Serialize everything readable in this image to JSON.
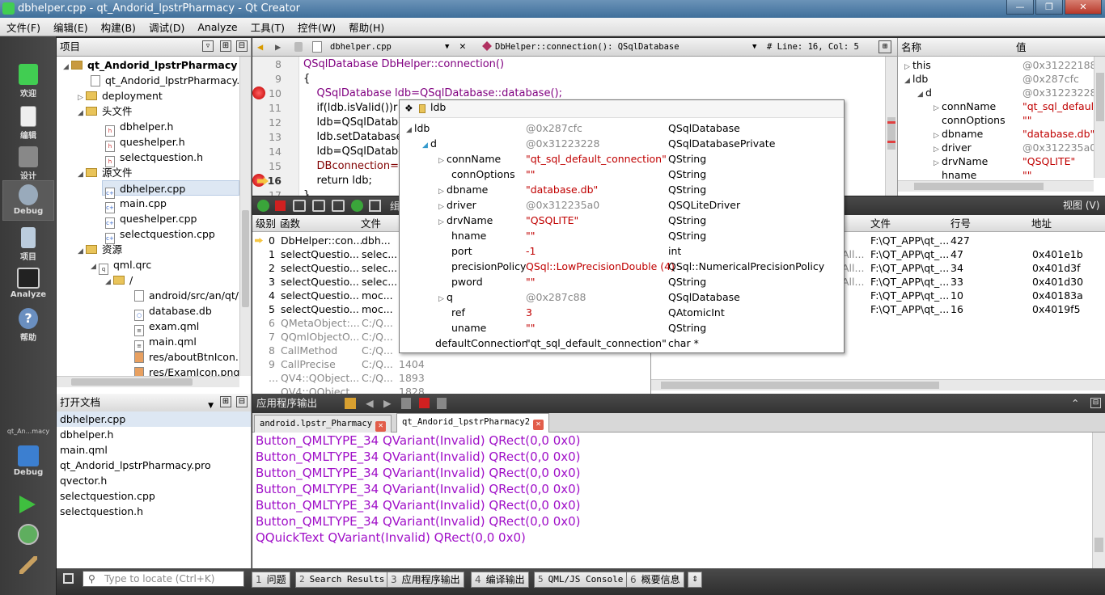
{
  "window": {
    "title": "dbhelper.cpp - qt_Andorid_lpstrPharmacy - Qt Creator"
  },
  "menu": [
    "文件(F)",
    "编辑(E)",
    "构建(B)",
    "调试(D)",
    "Analyze",
    "工具(T)",
    "控件(W)",
    "帮助(H)"
  ],
  "modes": [
    {
      "label": "欢迎",
      "icon": "qt-welcome-icon"
    },
    {
      "label": "编辑",
      "icon": "edit-icon"
    },
    {
      "label": "设计",
      "icon": "design-icon"
    },
    {
      "label": "Debug",
      "icon": "debug-bug-icon"
    },
    {
      "label": "项目",
      "icon": "project-icon"
    },
    {
      "label": "Analyze",
      "icon": "analyze-icon"
    },
    {
      "label": "帮助",
      "icon": "help-icon"
    }
  ],
  "kit": {
    "name": "qt_An...macy",
    "mode": "Debug"
  },
  "project_pane": {
    "title": "项目",
    "root": "qt_Andorid_lpstrPharmacy",
    "items": [
      "qt_Andorid_lpstrPharmacy.p",
      "deployment",
      "头文件",
      "dbhelper.h",
      "queshelper.h",
      "selectquestion.h",
      "源文件",
      "dbhelper.cpp",
      "main.cpp",
      "queshelper.cpp",
      "selectquestion.cpp",
      "资源",
      "qml.qrc",
      "/",
      "android/src/an/qt/",
      "database.db",
      "exam.qml",
      "main.qml",
      "res/aboutBtnIcon.p",
      "res/ExamIcon.png"
    ]
  },
  "open_docs": {
    "title": "打开文档",
    "items": [
      "dbhelper.cpp",
      "dbhelper.h",
      "main.qml",
      "qt_Andorid_lpstrPharmacy.pro",
      "qvector.h",
      "selectquestion.cpp",
      "selectquestion.h"
    ]
  },
  "editor": {
    "file": "dbhelper.cpp",
    "function": "DbHelper::connection(): QSqlDatabase",
    "position": "# Line: 16, Col: 5",
    "lines": [
      {
        "n": "8",
        "text": "QSqlDatabase DbHelper::connection()"
      },
      {
        "n": "9",
        "text": "{"
      },
      {
        "n": "10",
        "text": "    QSqlDatabase ldb=QSqlDatabase::database();"
      },
      {
        "n": "11",
        "text": "    if(ldb.isValid())r"
      },
      {
        "n": "12",
        "text": "    ldb=QSqlDatabc"
      },
      {
        "n": "13",
        "text": "    ldb.setDatabasel"
      },
      {
        "n": "14",
        "text": "    ldb=QSqlDatabc"
      },
      {
        "n": "15",
        "text": "    DBconnection=lc"
      },
      {
        "n": "16",
        "text": "    return ldb;"
      },
      {
        "n": "17",
        "text": "}"
      }
    ]
  },
  "tooltip": {
    "title": "ldb",
    "rows": [
      {
        "name": "ldb",
        "value": "@0x287cfc",
        "type": "QSqlDatabase"
      },
      {
        "name": "d",
        "value": "@0x31223228",
        "type": "QSqlDatabasePrivate"
      },
      {
        "name": "connName",
        "value": "\"qt_sql_default_connection\"",
        "type": "QString"
      },
      {
        "name": "connOptions",
        "value": "\"\"",
        "type": "QString"
      },
      {
        "name": "dbname",
        "value": "\"database.db\"",
        "type": "QString"
      },
      {
        "name": "driver",
        "value": "@0x312235a0",
        "type": "QSQLiteDriver"
      },
      {
        "name": "drvName",
        "value": "\"QSQLITE\"",
        "type": "QString"
      },
      {
        "name": "hname",
        "value": "\"\"",
        "type": "QString"
      },
      {
        "name": "port",
        "value": "-1",
        "type": "int"
      },
      {
        "name": "precisionPolicy",
        "value": "QSql::LowPrecisionDouble (4)",
        "type": "QSql::NumericalPrecisionPolicy"
      },
      {
        "name": "pword",
        "value": "\"\"",
        "type": "QString"
      },
      {
        "name": "q",
        "value": "@0x287c88",
        "type": "QSqlDatabase"
      },
      {
        "name": "ref",
        "value": "3",
        "type": "QAtomicInt"
      },
      {
        "name": "uname",
        "value": "\"\"",
        "type": "QString"
      },
      {
        "name": "defaultConnection",
        "value": "\"qt_sql_default_connection\"",
        "type": "char *"
      }
    ]
  },
  "locals": {
    "headers": [
      "名称",
      "值"
    ],
    "rows": [
      {
        "name": "this",
        "value": "@0x31222188"
      },
      {
        "name": "ldb",
        "value": "@0x287cfc"
      },
      {
        "name": "d",
        "value": "@0x31223228"
      },
      {
        "name": "connName",
        "value": "\"qt_sql_default"
      },
      {
        "name": "connOptions",
        "value": "\"\""
      },
      {
        "name": "dbname",
        "value": "\"database.db\""
      },
      {
        "name": "driver",
        "value": "@0x312235a0"
      },
      {
        "name": "drvName",
        "value": "\"QSQLITE\""
      },
      {
        "name": "hname",
        "value": "\"\""
      }
    ]
  },
  "stack": {
    "headers": [
      "级别",
      "函数",
      "文件"
    ],
    "rows": [
      {
        "lvl": "0",
        "fn": "DbHelper::con...",
        "file": "dbh..."
      },
      {
        "lvl": "1",
        "fn": "selectQuestio...",
        "file": "selec..."
      },
      {
        "lvl": "2",
        "fn": "selectQuestio...",
        "file": "selec..."
      },
      {
        "lvl": "3",
        "fn": "selectQuestio...",
        "file": "selec..."
      },
      {
        "lvl": "4",
        "fn": "selectQuestio...",
        "file": "moc..."
      },
      {
        "lvl": "5",
        "fn": "selectQuestio...",
        "file": "moc..."
      },
      {
        "lvl": "6",
        "fn": "QMetaObject:...",
        "file": "C:/Q..."
      },
      {
        "lvl": "7",
        "fn": "QQmlObjectO...",
        "file": "C:/Q..."
      },
      {
        "lvl": "8",
        "fn": "CallMethod",
        "file": "C:/Q..."
      },
      {
        "lvl": "9",
        "fn": "CallPrecise",
        "file": "C:/Q...",
        "line": "1404"
      },
      {
        "lvl": "...",
        "fn": "QV4::QObject...",
        "file": "C:/Q...",
        "line": "1893"
      },
      {
        "lvl": "",
        "fn": "QV4::QObject...",
        "file": "",
        "line": "1828"
      }
    ]
  },
  "breakpoints": {
    "view_label": "视图 (V)",
    "headers": [
      "文件",
      "行号",
      "地址"
    ],
    "rows": [
      {
        "file": "F:\\QT_APP\\qt_...",
        "line": "427",
        "addr": ""
      },
      {
        "file": "F:\\QT_APP\\qt_...",
        "line": "47",
        "addr": "0x401e1b"
      },
      {
        "file": "F:\\QT_APP\\qt_...",
        "line": "34",
        "addr": "0x401d3f"
      },
      {
        "file": "F:\\QT_APP\\qt_...",
        "line": "33",
        "addr": "0x401d30"
      },
      {
        "file": "F:\\QT_APP\\qt_...",
        "line": "10",
        "addr": "0x40183a"
      },
      {
        "file": "F:\\QT_APP\\qt_...",
        "line": "16",
        "addr": "0x4019f5"
      }
    ],
    "left_frag": [
      "All...",
      "All...",
      "All..."
    ]
  },
  "output": {
    "title": "应用程序输出",
    "tabs": [
      "android.lpstr_Pharmacy",
      "qt_Andorid_lpstrPharmacy2"
    ],
    "lines": [
      "Button_QMLTYPE_34 QVariant(Invalid) QRect(0,0 0x0)",
      "Button_QMLTYPE_34 QVariant(Invalid) QRect(0,0 0x0)",
      "Button_QMLTYPE_34 QVariant(Invalid) QRect(0,0 0x0)",
      "Button_QMLTYPE_34 QVariant(Invalid) QRect(0,0 0x0)",
      "Button_QMLTYPE_34 QVariant(Invalid) QRect(0,0 0x0)",
      "Button_QMLTYPE_34 QVariant(Invalid) QRect(0,0 0x0)",
      "QQuickText QVariant(Invalid) QRect(0,0 0x0)"
    ]
  },
  "statusbar": {
    "locate_placeholder": "Type to locate (Ctrl+K)",
    "tabs": [
      {
        "n": "1",
        "label": "问题"
      },
      {
        "n": "2",
        "label": "Search Results"
      },
      {
        "n": "3",
        "label": "应用程序输出"
      },
      {
        "n": "4",
        "label": "编译输出"
      },
      {
        "n": "5",
        "label": "QML/JS Console"
      },
      {
        "n": "6",
        "label": "概要信息"
      }
    ]
  },
  "debug_toolbar_frag": "缉"
}
